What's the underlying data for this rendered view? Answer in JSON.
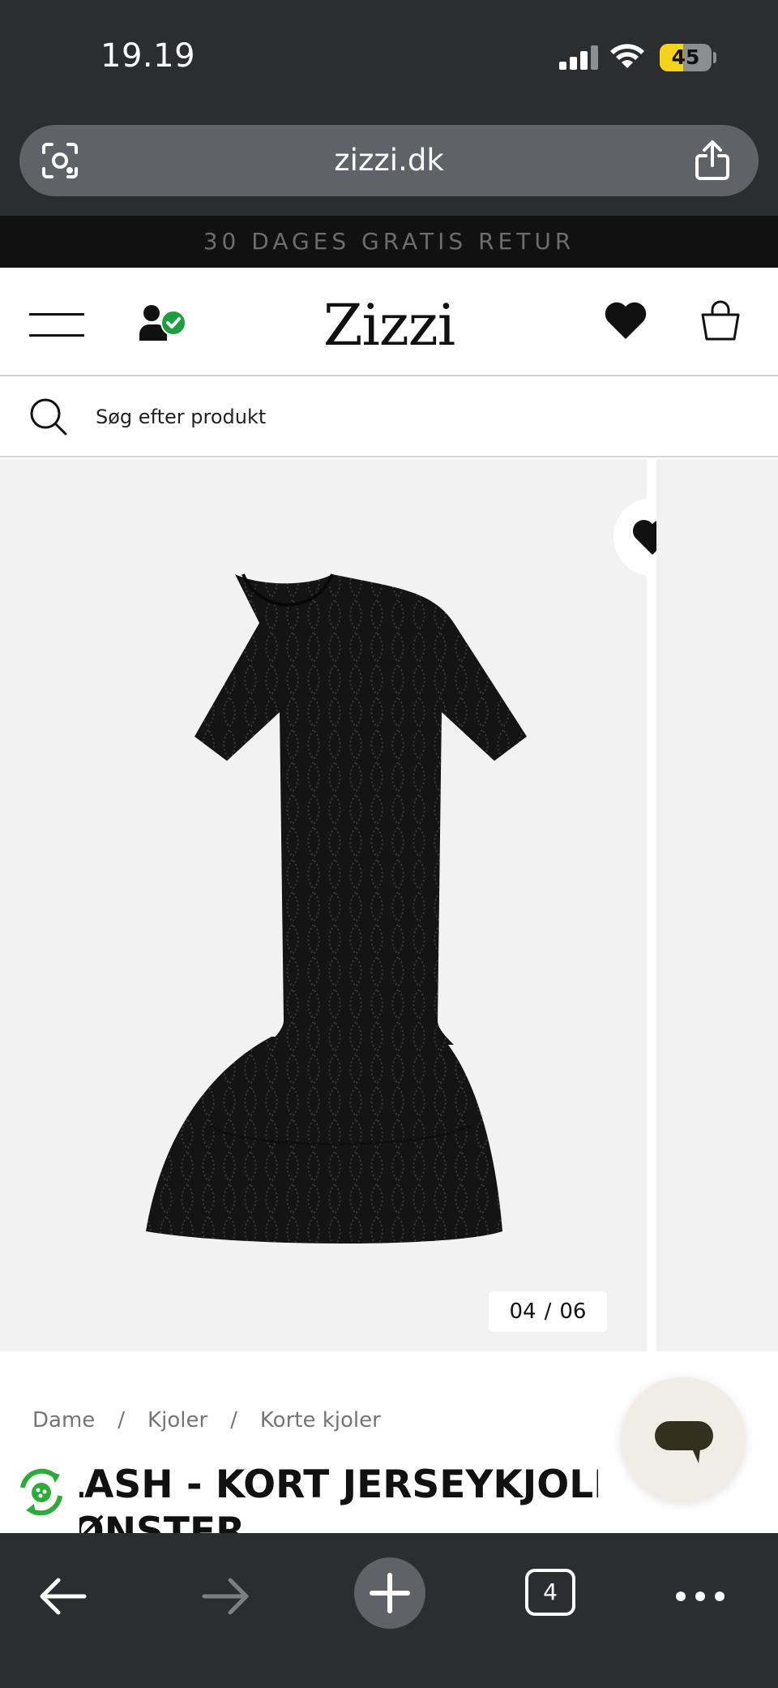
{
  "status_bar": {
    "time": "19.19",
    "battery_level": "45",
    "battery_fraction": 0.45,
    "signal_bars": 3
  },
  "browser": {
    "url": "zizzi.dk",
    "tab_count": "4"
  },
  "promo": {
    "text": "30 DAGES GRATIS RETUR"
  },
  "header": {
    "logo": "Zizzi"
  },
  "search": {
    "placeholder": "Søg efter produkt"
  },
  "gallery": {
    "current": "04",
    "separator": "/",
    "total": "06"
  },
  "breadcrumb": {
    "items": [
      "Dame",
      "Kjoler",
      "Korte kjoler"
    ],
    "separator": "/"
  },
  "product": {
    "title_line1": "FLASH - KORT JERSEYKJOLE MED",
    "title_line2": "MØNSTER"
  },
  "icons": [
    "camera-lens-icon",
    "share-icon",
    "menu-icon",
    "account-verified-icon",
    "heart-icon",
    "bag-icon",
    "search-icon",
    "chat-icon",
    "recycle-icon",
    "back-arrow-icon",
    "forward-arrow-icon",
    "plus-icon",
    "more-icon"
  ],
  "colors": {
    "chrome": "#2b2d30",
    "promo_bg": "#111111",
    "battery": "#f3d41a",
    "verified": "#1e9e3e",
    "eco_green": "#2eaa3a",
    "gallery_bg": "#f2f2f2"
  }
}
